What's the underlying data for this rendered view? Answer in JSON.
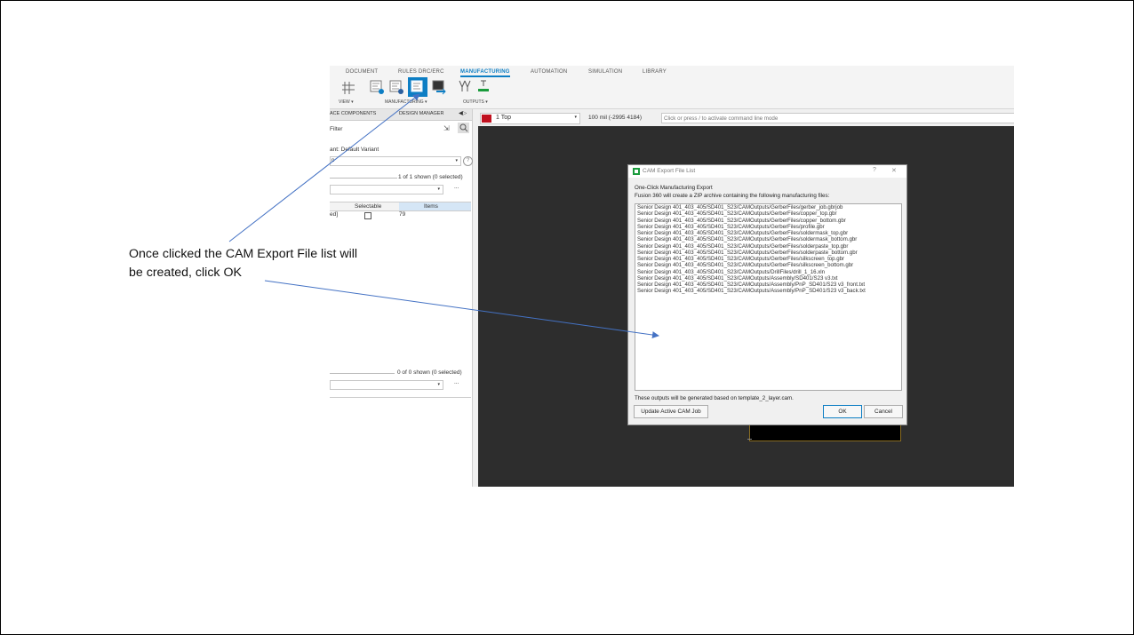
{
  "slide": {
    "annotation_line1": "Once clicked the CAM Export File list will",
    "annotation_line2": "be created,  click OK"
  },
  "ribbon": {
    "tabs": [
      "DOCUMENT",
      "RULES DRC/ERC",
      "MANUFACTURING",
      "AUTOMATION",
      "SIMULATION",
      "LIBRARY"
    ],
    "active_tab": "MANUFACTURING",
    "groups": {
      "view": "VIEW ▾",
      "manufacturing": "MANUFACTURING ▾",
      "outputs": "OUTPUTS ▾"
    },
    "accent_color": "#0d7ec4"
  },
  "left_panel": {
    "tab_components": "ACE COMPONENTS",
    "tab_design_manager": "DESIGN MANAGER",
    "filter_label": "Filter",
    "variant_label": "ant:  Default Variant",
    "variant_dropdown": "n",
    "shown_top": "1 of 1 shown (0 selected)",
    "table_headers": {
      "selectable": "Selectable",
      "items": "Items"
    },
    "table_row": {
      "name": "ed]",
      "items": "79"
    },
    "shown_bottom": "0 of 0 shown (0 selected)",
    "more_label": "..."
  },
  "canvas_bar": {
    "layer": "1 Top",
    "layer_color": "#c0111f",
    "coords": "100 mil (-2995 4184)",
    "command_placeholder": "Click or press / to activate command line mode"
  },
  "dialog": {
    "title": "CAM Export File List",
    "help": "?",
    "close": "✕",
    "heading": "One-Click Manufacturing Export",
    "description": "Fusion 360 will create a ZIP archive containing the following manufacturing files:",
    "files": [
      "Senior Design 401_403_405/SD401_S23/CAMOutputs/GerberFiles/gerber_job.gbrjob",
      "Senior Design 401_403_405/SD401_S23/CAMOutputs/GerberFiles/copper_top.gbr",
      "Senior Design 401_403_405/SD401_S23/CAMOutputs/GerberFiles/copper_bottom.gbr",
      "Senior Design 401_403_405/SD401_S23/CAMOutputs/GerberFiles/profile.gbr",
      "Senior Design 401_403_405/SD401_S23/CAMOutputs/GerberFiles/soldermask_top.gbr",
      "Senior Design 401_403_405/SD401_S23/CAMOutputs/GerberFiles/soldermask_bottom.gbr",
      "Senior Design 401_403_405/SD401_S23/CAMOutputs/GerberFiles/solderpaste_top.gbr",
      "Senior Design 401_403_405/SD401_S23/CAMOutputs/GerberFiles/solderpaste_bottom.gbr",
      "Senior Design 401_403_405/SD401_S23/CAMOutputs/GerberFiles/silkscreen_top.gbr",
      "Senior Design 401_403_405/SD401_S23/CAMOutputs/GerberFiles/silkscreen_bottom.gbr",
      "Senior Design 401_403_405/SD401_S23/CAMOutputs/DrillFiles/drill_1_16.xln",
      "Senior Design 401_403_405/SD401_S23/CAMOutputs/Assembly/SD401/S23 v3.txt",
      "Senior Design 401_403_405/SD401_S23/CAMOutputs/Assembly/PnP_SD401/S23 v3_front.txt",
      "Senior Design 401_403_405/SD401_S23/CAMOutputs/Assembly/PnP_SD401/S23 v3_back.txt"
    ],
    "footer_note": "These outputs will be generated based on template_2_layer.cam.",
    "update_button": "Update Active CAM Job",
    "ok_button": "OK",
    "cancel_button": "Cancel"
  }
}
